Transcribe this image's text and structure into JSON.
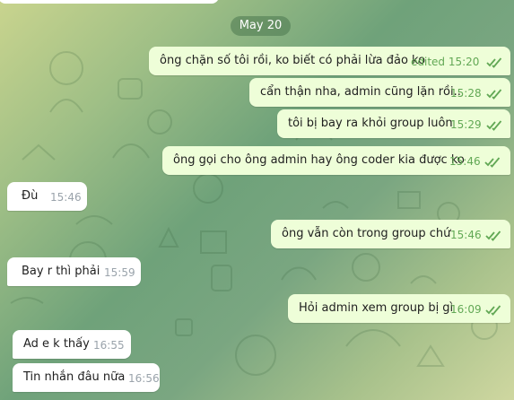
{
  "date_separator": "May 20",
  "messages": [
    {
      "text": "ông chặn số tôi rồi, ko biết có phải lừa đảo ko",
      "meta": "edited 15:20",
      "direction": "out",
      "status": "read"
    },
    {
      "text": "cẩn thận nha, admin cũng lặn rồi..",
      "meta": "15:28",
      "direction": "out",
      "status": "read"
    },
    {
      "text": "tôi bị bay ra khỏi group luôn",
      "meta": "15:29",
      "direction": "out",
      "status": "read"
    },
    {
      "text": "ông gọi cho ông admin hay ông coder kia được ko",
      "meta": "15:46",
      "direction": "out",
      "status": "read"
    },
    {
      "text": "Đù",
      "meta": "15:46",
      "direction": "in"
    },
    {
      "text": "ông vẫn còn trong group chứ",
      "meta": "15:46",
      "direction": "out",
      "status": "read"
    },
    {
      "text": "Bay r thì phải",
      "meta": "15:59",
      "direction": "in"
    },
    {
      "text": "Hỏi admin xem group bị gì",
      "meta": "16:09",
      "direction": "out",
      "status": "read"
    },
    {
      "text": "Ad e k thấy",
      "meta": "16:55",
      "direction": "in"
    },
    {
      "text": "Tin nhắn đâu nữa",
      "meta": "16:56",
      "direction": "in"
    }
  ],
  "icons": {
    "read_receipt": "double-check-icon",
    "top_bubble_icon": "partial-red-circle-icon"
  },
  "colors": {
    "outgoing_bubble": "#eefed8",
    "incoming_bubble": "#ffffff",
    "outgoing_meta": "#62a855",
    "incoming_meta": "#9aa3ab",
    "date_pill": "#4a764e"
  }
}
